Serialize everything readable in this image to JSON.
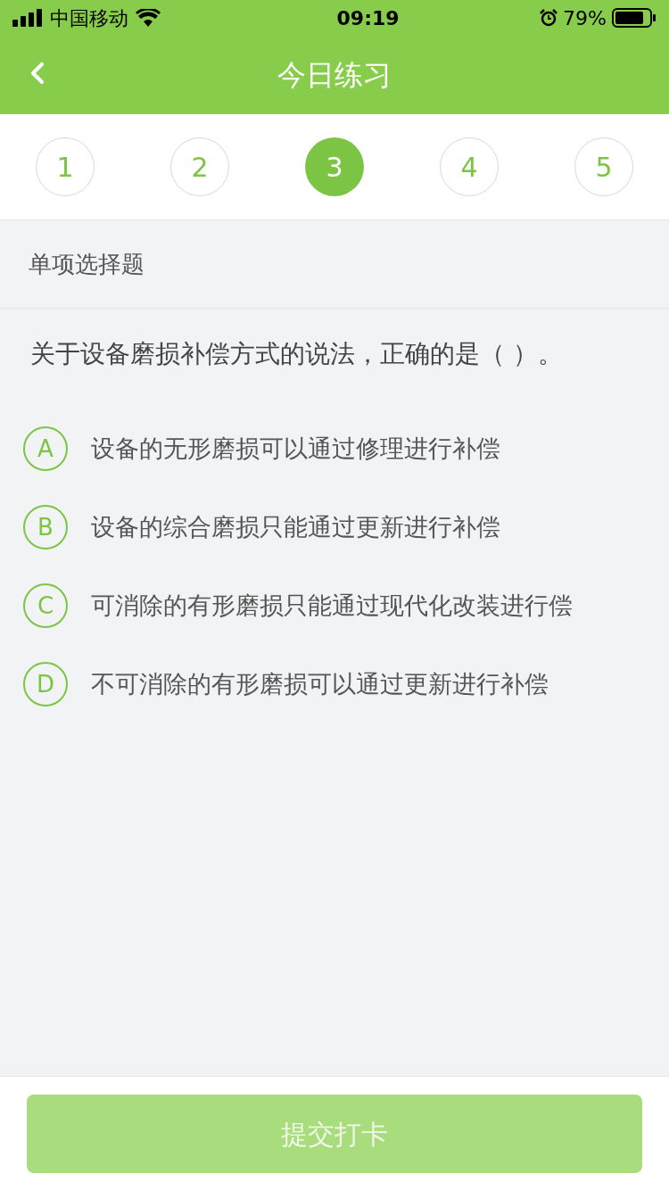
{
  "status_bar": {
    "carrier": "中国移动",
    "time": "09:19",
    "battery": "79%"
  },
  "header": {
    "title": "今日练习"
  },
  "steps": [
    {
      "label": "1",
      "selected": false
    },
    {
      "label": "2",
      "selected": false
    },
    {
      "label": "3",
      "selected": true
    },
    {
      "label": "4",
      "selected": false
    },
    {
      "label": "5",
      "selected": false
    }
  ],
  "section": {
    "title": "单项选择题"
  },
  "question": {
    "text": "关于设备磨损补偿方式的说法，正确的是（    ）。"
  },
  "options": [
    {
      "letter": "A",
      "text": "设备的无形磨损可以通过修理进行补偿",
      "selected": false
    },
    {
      "letter": "B",
      "text": "设备的综合磨损只能通过更新进行补偿",
      "selected": false
    },
    {
      "letter": "C",
      "text": "可消除的有形磨损只能通过现代化改装进行偿",
      "selected": false
    },
    {
      "letter": "D",
      "text": "不可消除的有形磨损可以通过更新进行补偿",
      "selected": false
    }
  ],
  "submit": {
    "label": "提交打卡",
    "disabled": true
  }
}
